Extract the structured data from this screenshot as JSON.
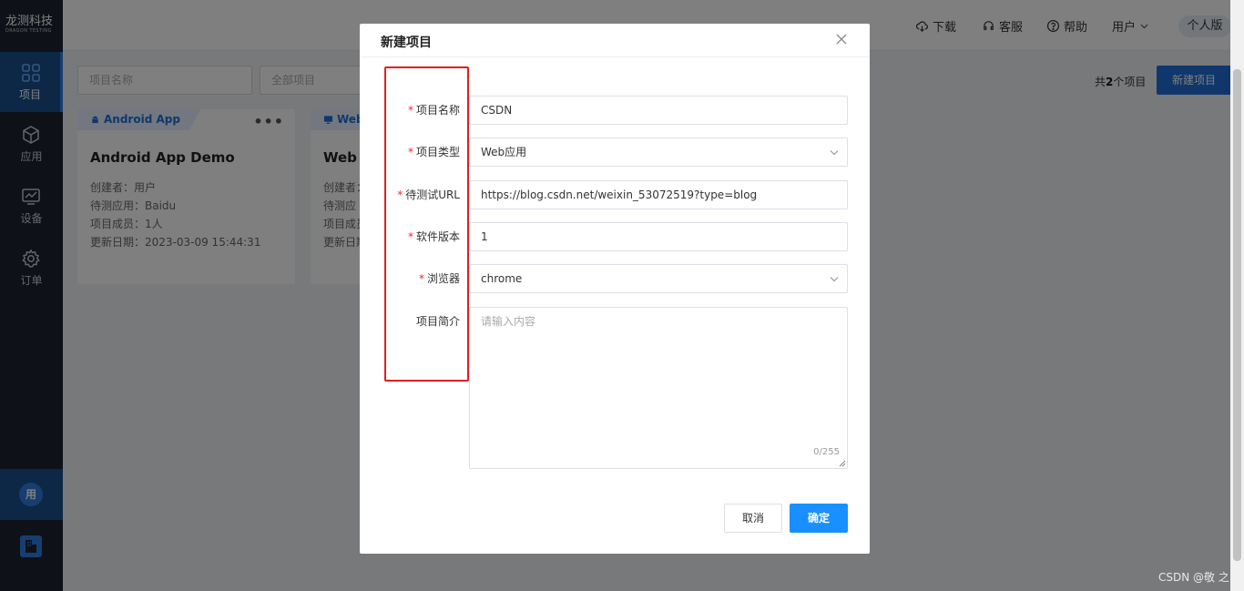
{
  "brand": {
    "name_cn": "龙测科技",
    "name_en": "DRAGON TESTING"
  },
  "sidebar": {
    "items": [
      {
        "label": "项目",
        "icon": "grid-icon",
        "active": true
      },
      {
        "label": "应用",
        "icon": "cube-icon"
      },
      {
        "label": "设备",
        "icon": "monitor-icon"
      },
      {
        "label": "订单",
        "icon": "gear-icon"
      }
    ],
    "avatar_text": "用"
  },
  "header": {
    "download": "下载",
    "service": "客服",
    "help": "帮助",
    "user": "用户",
    "edition": "个人版"
  },
  "filters": {
    "name_placeholder": "项目名称",
    "type_placeholder": "全部项目"
  },
  "summary": {
    "prefix": "共",
    "count": "2",
    "suffix": "个项目"
  },
  "new_project_button": "新建项目",
  "cards": [
    {
      "tag": "Android App",
      "title": "Android App Demo",
      "creator": "创建者：用户",
      "app": "待测应用：Baidu",
      "members": "项目成员：1人",
      "updated": "更新日期：2023-03-09 15:44:31"
    },
    {
      "tag": "Web",
      "title": "Web D",
      "creator": "创建者：",
      "app": "待测应",
      "members": "项目成员",
      "updated": "更新日期"
    }
  ],
  "modal": {
    "title": "新建项目",
    "fields": {
      "name": {
        "label": "项目名称",
        "value": "CSDN",
        "required": true
      },
      "type": {
        "label": "项目类型",
        "value": "Web应用",
        "required": true
      },
      "url": {
        "label": "待测试URL",
        "value": "https://blog.csdn.net/weixin_53072519?type=blog",
        "required": true
      },
      "version": {
        "label": "软件版本",
        "value": "1",
        "required": true
      },
      "browser": {
        "label": "浏览器",
        "value": "chrome",
        "required": true
      },
      "intro": {
        "label": "项目简介",
        "placeholder": "请输入内容",
        "counter": "0/255"
      }
    },
    "cancel": "取消",
    "confirm": "确定"
  },
  "watermark": "CSDN @敬 之",
  "colors": {
    "primary": "#1890ff",
    "sidebar": "#1d2330",
    "highlight": "#e02020"
  }
}
